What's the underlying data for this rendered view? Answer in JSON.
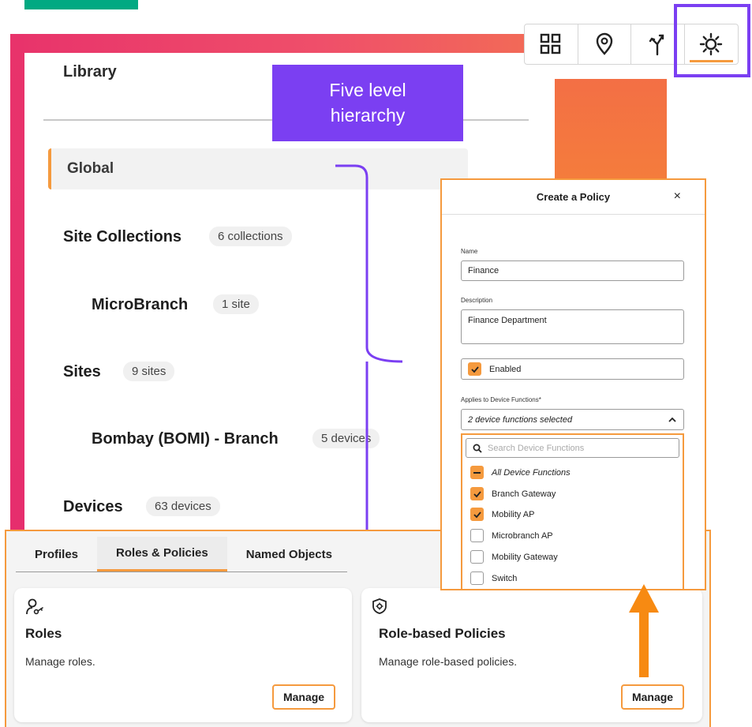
{
  "colors": {
    "brand_green": "#01a982",
    "accent_orange": "#f59a3e",
    "callout_purple": "#7b3ff2",
    "band_pink": "#e8336b",
    "band_coral": "#f36f45"
  },
  "callout": {
    "line1": "Five level",
    "line2": "hierarchy"
  },
  "library": {
    "title": "Library",
    "global": "Global",
    "site_collections": {
      "label": "Site Collections",
      "count": "6 collections"
    },
    "microbranch": {
      "label": "MicroBranch",
      "count": "1 site"
    },
    "sites": {
      "label": "Sites",
      "count": "9 sites"
    },
    "branch": {
      "label": "Bombay (BOMI) - Branch",
      "count": "5 devices"
    },
    "devices": {
      "label": "Devices",
      "count": "63 devices"
    }
  },
  "toolbar": {
    "icons": [
      "grid-icon",
      "location-pin-icon",
      "split-arrow-icon",
      "gear-icon"
    ],
    "active_index": 3
  },
  "tabs": {
    "items": [
      "Profiles",
      "Roles & Policies",
      "Named Objects"
    ],
    "active": "Roles & Policies"
  },
  "cards": {
    "roles": {
      "title": "Roles",
      "description": "Manage roles.",
      "button": "Manage",
      "icon": "user-key-icon"
    },
    "policies": {
      "title": "Role-based Policies",
      "description": "Manage role-based policies.",
      "button": "Manage",
      "icon": "shield-gear-icon"
    }
  },
  "modal": {
    "title": "Create a Policy",
    "close": "×",
    "name_label": "Name",
    "name_value": "Finance",
    "description_label": "Description",
    "description_value": "Finance Department",
    "enabled_label": "Enabled",
    "enabled_checked": true,
    "applies_label": "Applies to Device Functions*",
    "applies_value": "2 device functions selected",
    "search_placeholder": "Search Device Functions",
    "options": [
      {
        "label": "All Device Functions",
        "state": "partial"
      },
      {
        "label": "Branch Gateway",
        "state": "checked"
      },
      {
        "label": "Mobility AP",
        "state": "checked"
      },
      {
        "label": "Microbranch AP",
        "state": "unchecked"
      },
      {
        "label": "Mobility Gateway",
        "state": "unchecked"
      },
      {
        "label": "Switch",
        "state": "unchecked"
      }
    ]
  }
}
